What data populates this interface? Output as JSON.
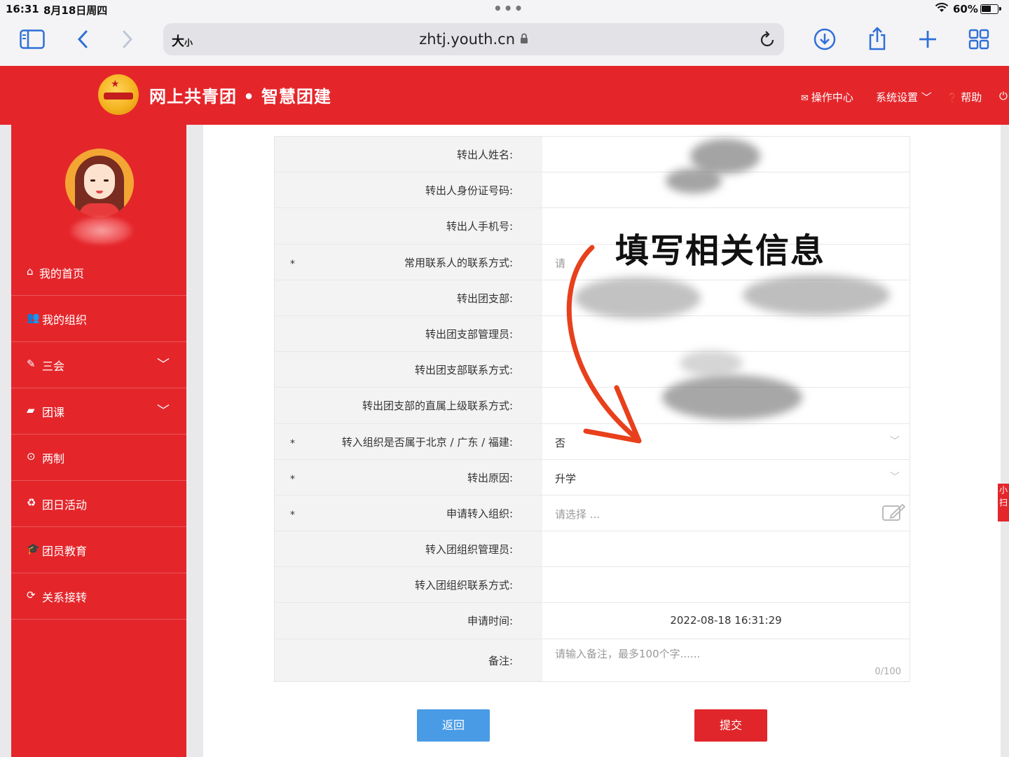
{
  "statusbar": {
    "time": "16:31",
    "date": "8月18日周四",
    "battery": "60%",
    "battery_level": 0.6
  },
  "browser": {
    "text_size": "大",
    "text_size_small": "小",
    "url": "zhtj.youth.cn"
  },
  "header": {
    "title": "网上共青团 • 智慧团建",
    "menu": [
      {
        "icon": "envelope-icon",
        "label": "操作中心"
      },
      {
        "icon": "settings-dropdown",
        "label": "系统设置"
      },
      {
        "icon": "help-icon",
        "label": "帮助"
      }
    ]
  },
  "sidebar": {
    "items": [
      {
        "icon": "home-icon",
        "label": "我的首页"
      },
      {
        "icon": "users-icon",
        "label": "我的组织"
      },
      {
        "icon": "edit-icon",
        "label": "三会"
      },
      {
        "icon": "folder-icon",
        "label": "团课"
      },
      {
        "icon": "circle-icon",
        "label": "两制"
      },
      {
        "icon": "recycle-icon",
        "label": "团日活动"
      },
      {
        "icon": "graduation-cap-icon",
        "label": "团员教育"
      },
      {
        "icon": "refresh-icon",
        "label": "关系接转"
      }
    ]
  },
  "form": {
    "rows": [
      {
        "label": "转出人姓名:",
        "required": false,
        "value": ""
      },
      {
        "label": "转出人身份证号码:",
        "required": false,
        "value": ""
      },
      {
        "label": "转出人手机号:",
        "required": false,
        "value": ""
      },
      {
        "label": "常用联系人的联系方式:",
        "required": true,
        "value": "",
        "placeholder": "请"
      },
      {
        "label": "转出团支部:",
        "required": false,
        "value": ""
      },
      {
        "label": "转出团支部管理员:",
        "required": false,
        "value": ""
      },
      {
        "label": "转出团支部联系方式:",
        "required": false,
        "value": ""
      },
      {
        "label": "转出团支部的直属上级联系方式:",
        "required": false,
        "value": ""
      },
      {
        "label": "转入组织是否属于北京 / 广东 / 福建:",
        "required": true,
        "value": "否"
      },
      {
        "label": "转出原因:",
        "required": true,
        "value": "升学"
      },
      {
        "label": "申请转入组织:",
        "required": true,
        "value": "",
        "placeholder": "请选择 ..."
      },
      {
        "label": "转入团组织管理员:",
        "required": false,
        "value": ""
      },
      {
        "label": "转入团组织联系方式:",
        "required": false,
        "value": ""
      },
      {
        "label": "申请时间:",
        "required": false,
        "value": "2022-08-18 16:31:29"
      },
      {
        "label": "备注:",
        "required": false,
        "value": "",
        "placeholder": "请输入备注，最多100个字......",
        "counter": "0/100"
      }
    ],
    "required_mark": "*",
    "back_label": "返回",
    "submit_label": "提交"
  },
  "annotation": {
    "text": "填写相关信息",
    "color": "#e8401c"
  },
  "float_tab": {
    "line1": "小",
    "line2": "扫"
  },
  "colors": {
    "brand_red": "#e4262b",
    "button_blue": "#4a9be6"
  }
}
